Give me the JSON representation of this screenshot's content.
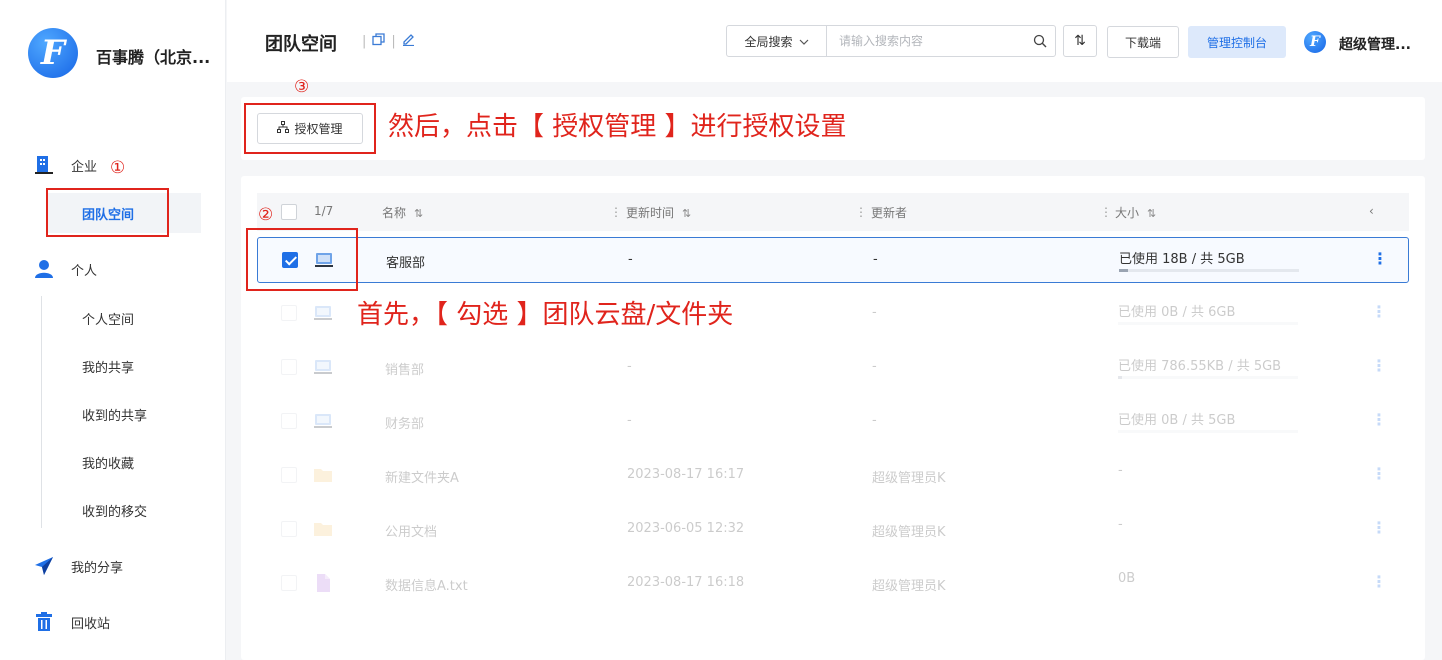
{
  "sidebar": {
    "company": "百事腾（北京...",
    "enterprise": "企业",
    "team_space": "团队空间",
    "personal": "个人",
    "personal_items": [
      "个人空间",
      "我的共享",
      "收到的共享",
      "我的收藏",
      "收到的移交"
    ],
    "my_share": "我的分享",
    "recycle": "回收站"
  },
  "header": {
    "title": "团队空间",
    "search_type": "全局搜索",
    "search_placeholder": "请输入搜索内容",
    "sort_glyph": "⇅",
    "download": "下载端",
    "admin": "管理控制台",
    "user": "超级管理..."
  },
  "toolbar": {
    "auth": "授权管理"
  },
  "table": {
    "count": "1/7",
    "columns": {
      "name": "名称",
      "updated": "更新时间",
      "updater": "更新者",
      "size": "大小"
    },
    "rows": [
      {
        "name": "客服部",
        "updated": "-",
        "updater": "-",
        "size": "已使用 18B / 共 5GB",
        "type": "disk",
        "usage": 0.05,
        "checked": true
      },
      {
        "name": "",
        "updated": "-",
        "updater": "-",
        "size": "已使用 0B / 共 6GB",
        "type": "disk",
        "usage": 0.0,
        "checked": false
      },
      {
        "name": "销售部",
        "updated": "-",
        "updater": "-",
        "size": "已使用 786.55KB / 共 5GB",
        "type": "disk",
        "usage": 0.02,
        "checked": false
      },
      {
        "name": "财务部",
        "updated": "-",
        "updater": "-",
        "size": "已使用 0B / 共 5GB",
        "type": "disk",
        "usage": 0.0,
        "checked": false
      },
      {
        "name": "新建文件夹A",
        "updated": "2023-08-17 16:17",
        "updater": "超级管理员K",
        "size": "-",
        "type": "folder",
        "checked": false
      },
      {
        "name": "公用文档",
        "updated": "2023-06-05 12:32",
        "updater": "超级管理员K",
        "size": "-",
        "type": "folder",
        "checked": false
      },
      {
        "name": "数据信息A.txt",
        "updated": "2023-08-17 16:18",
        "updater": "超级管理员K",
        "size": "0B",
        "type": "file",
        "checked": false
      }
    ]
  },
  "annotations": {
    "step1": "①",
    "step2": "②",
    "step3": "③",
    "text_first": "首先，【 勾选 】团队云盘/文件夹",
    "text_then": "然后，点击【 授权管理 】进行授权设置"
  },
  "colors": {
    "accent": "#1f6fe6",
    "annotation": "#e0241c"
  }
}
